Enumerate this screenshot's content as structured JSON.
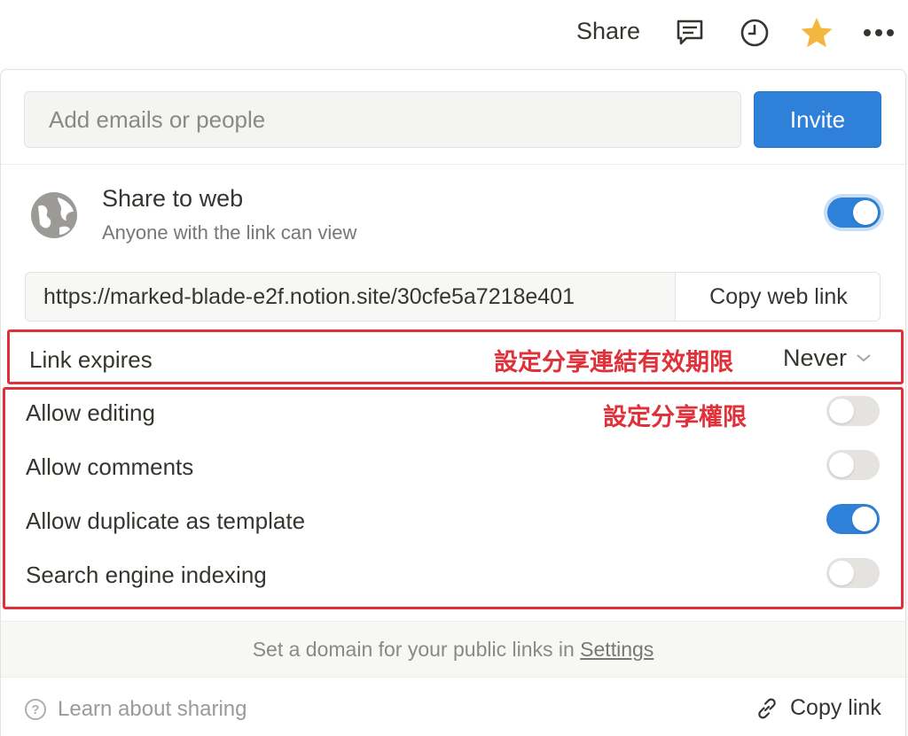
{
  "topbar": {
    "share_label": "Share",
    "icons": [
      "comment-icon",
      "clock-icon",
      "star-icon",
      "more-icon"
    ],
    "star_color": "#f3b73f"
  },
  "invite": {
    "placeholder": "Add emails or people",
    "button_label": "Invite"
  },
  "share_to_web": {
    "title": "Share to web",
    "subtitle": "Anyone with the link can view",
    "enabled": true
  },
  "web_link": {
    "url": "https://marked-blade-e2f.notion.site/30cfe5a7218e401",
    "copy_label": "Copy web link"
  },
  "link_expires": {
    "label": "Link expires",
    "annotation": "設定分享連結有效期限",
    "value": "Never"
  },
  "permissions": {
    "annotation": "設定分享權限",
    "items": [
      {
        "label": "Allow editing",
        "enabled": false
      },
      {
        "label": "Allow comments",
        "enabled": false
      },
      {
        "label": "Allow duplicate as template",
        "enabled": true
      },
      {
        "label": "Search engine indexing",
        "enabled": false
      }
    ]
  },
  "domain_hint": {
    "text": "Set a domain for your public links in",
    "link": "Settings"
  },
  "footer": {
    "learn_label": "Learn about sharing",
    "copy_link_label": "Copy link"
  },
  "colors": {
    "accent": "#2f80d8",
    "annotation_red": "#e0313a",
    "toggle_off": "#e4e3e0"
  }
}
